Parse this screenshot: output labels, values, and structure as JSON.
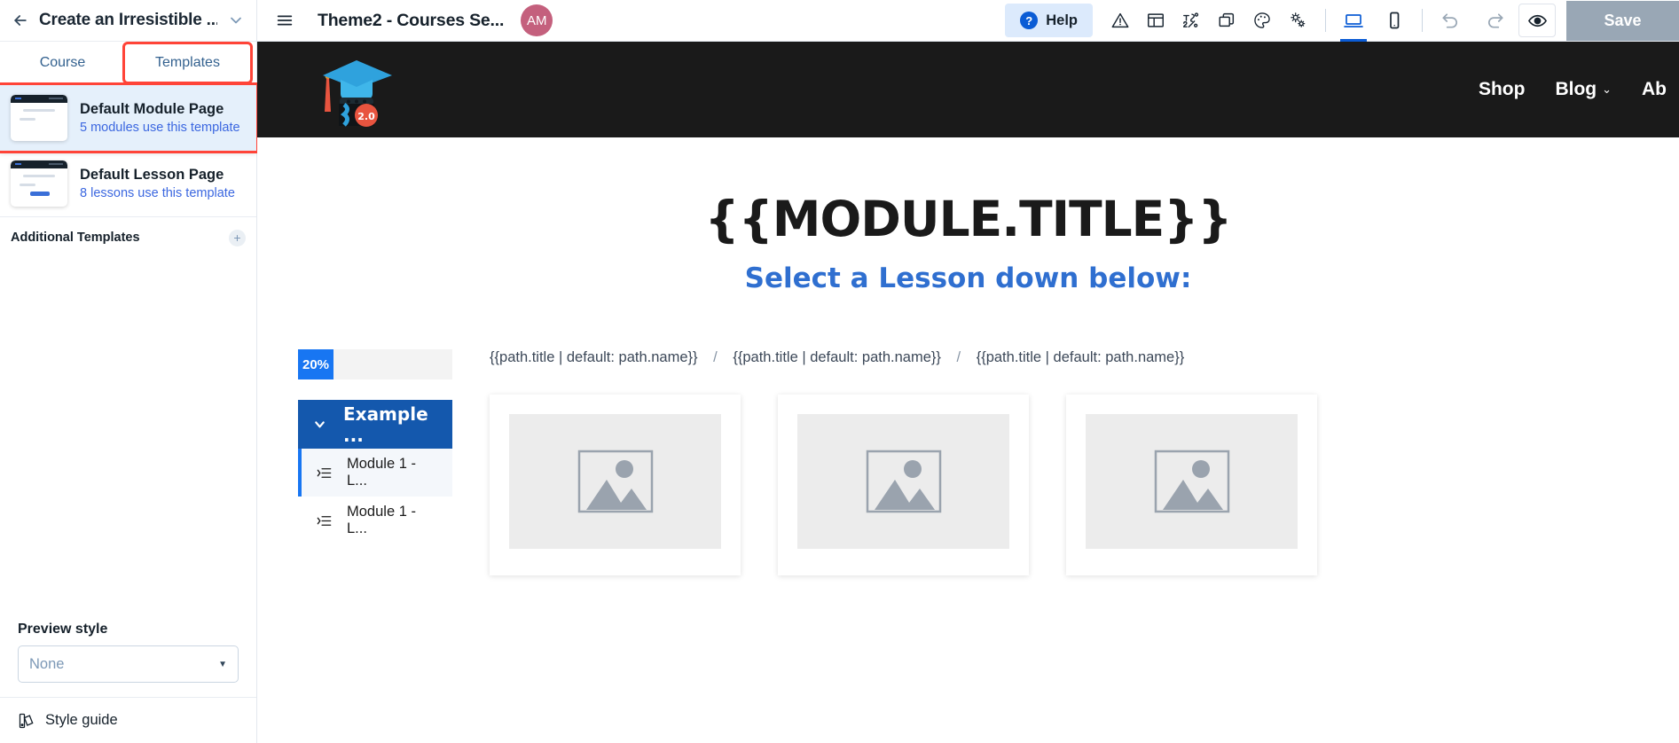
{
  "sidebar": {
    "back_icon": "arrow-left-icon",
    "title": "Create an Irresistible ...",
    "expand_icon": "chevron-down-icon",
    "tabs": [
      {
        "label": "Course",
        "active": false,
        "highlighted": false
      },
      {
        "label": "Templates",
        "active": true,
        "highlighted": true
      }
    ],
    "templates": [
      {
        "name": "Default Module Page",
        "usage": "5 modules use this template",
        "selected": true,
        "highlighted": true
      },
      {
        "name": "Default Lesson Page",
        "usage": "8 lessons use this template",
        "selected": false,
        "highlighted": false
      }
    ],
    "additional_templates": {
      "label": "Additional Templates",
      "add_icon": "plus-icon"
    },
    "preview_style": {
      "label": "Preview style",
      "value": "None",
      "caret_icon": "caret-down-icon"
    },
    "style_guide": {
      "label": "Style guide",
      "icon": "style-guide-icon"
    }
  },
  "toolbar": {
    "menu_icon": "hamburger-menu-icon",
    "title": "Theme2 - Courses Se...",
    "avatar_initials": "AM",
    "help": {
      "label": "Help",
      "icon": "question-mark-icon"
    },
    "icons": [
      {
        "name": "warning-triangle-icon"
      },
      {
        "name": "layout-panel-icon"
      },
      {
        "name": "typography-icon"
      },
      {
        "name": "duplicate-icon"
      },
      {
        "name": "palette-icon"
      },
      {
        "name": "settings-gears-icon"
      }
    ],
    "device_icons": [
      {
        "name": "desktop-icon",
        "active": true
      },
      {
        "name": "mobile-icon",
        "active": false
      }
    ],
    "history_icons": [
      {
        "name": "undo-icon"
      },
      {
        "name": "redo-icon"
      }
    ],
    "preview_icon": "eye-icon",
    "save_label": "Save"
  },
  "canvas": {
    "site_nav": [
      {
        "label": "Shop",
        "has_caret": false
      },
      {
        "label": "Blog",
        "has_caret": true
      },
      {
        "label": "Ab",
        "has_caret": false
      }
    ],
    "hero": {
      "title": "{{MODULE.TITLE}}",
      "subtitle": "Select a Lesson down below:"
    },
    "breadcrumbs": [
      "{{path.title | default: path.name}}",
      "{{path.title | default: path.name}}",
      "{{path.title | default: path.name}}"
    ],
    "breadcrumb_separator": "/",
    "progress": {
      "value": "20%"
    },
    "accordion": {
      "header": {
        "label": "Example ...",
        "caret_icon": "chevron-down-icon"
      },
      "items": [
        {
          "label": "Module 1 - L...",
          "icon": "list-indent-icon",
          "active": true
        },
        {
          "label": "Module 1 - L...",
          "icon": "list-indent-icon",
          "active": false
        }
      ]
    },
    "cards": [
      {
        "image_placeholder_icon": "image-placeholder-icon"
      },
      {
        "image_placeholder_icon": "image-placeholder-icon"
      },
      {
        "image_placeholder_icon": "image-placeholder-icon"
      }
    ]
  },
  "colors": {
    "accent_blue": "#0b5cd5",
    "highlight_red": "#ff4438",
    "site_header_bg": "#1a1a1a",
    "avatar_bg": "#c4607d",
    "save_bg": "#99a7b5",
    "progress_blue": "#1876f2",
    "accordion_blue": "#1458ad"
  }
}
